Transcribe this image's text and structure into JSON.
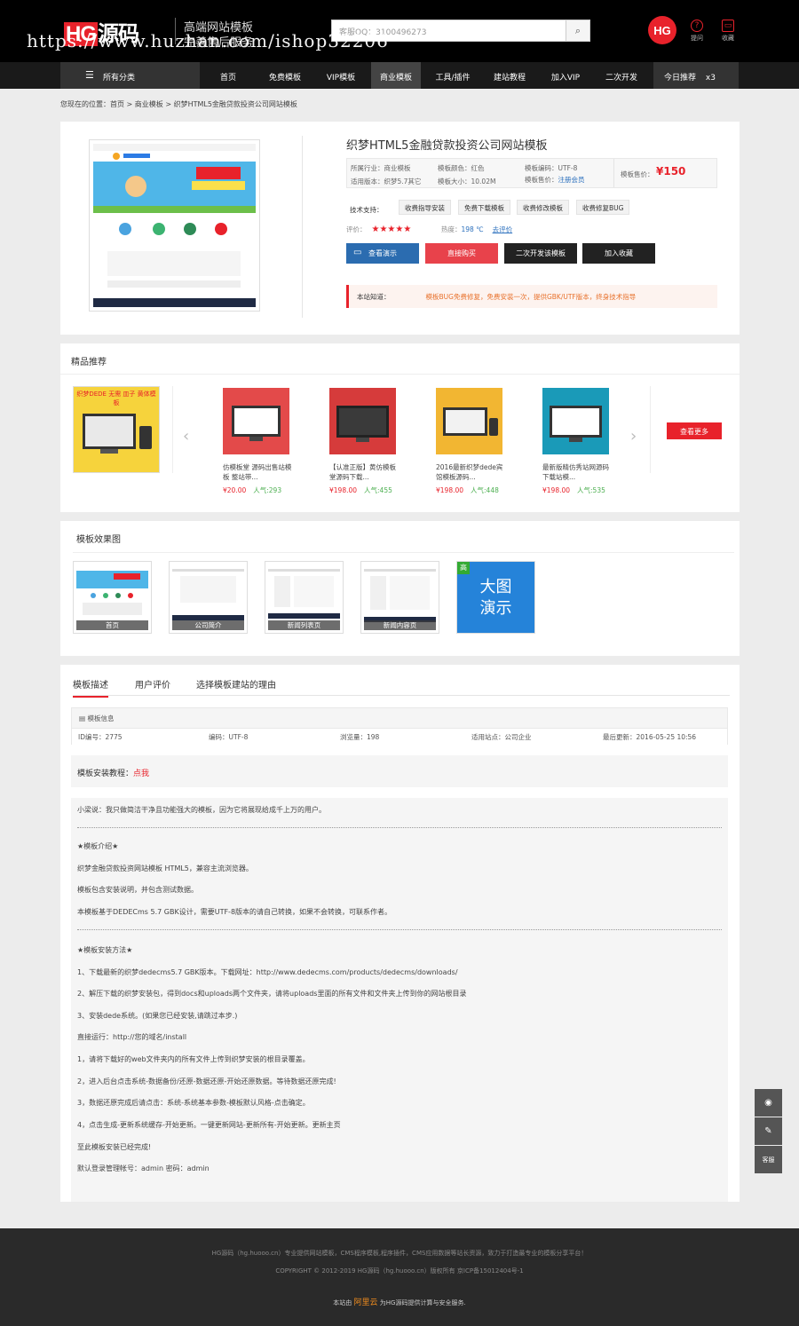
{
  "header": {
    "logo_hg": "HG",
    "logo_text": "源码",
    "tagline1": "高端网站模板",
    "tagline2": "完善售后服务",
    "watermark": "https://www.huzhan.com/ishop32206",
    "search_placeholder": "客服QQ：3100496273",
    "brand_badge": "HG",
    "icon1_label": "提问",
    "icon2_label": "收藏"
  },
  "nav": {
    "all_categories": "所有分类",
    "items": [
      "首页",
      "免费模板",
      "VIP模板",
      "商业模板",
      "工具/插件",
      "建站教程",
      "加入VIP",
      "二次开发"
    ],
    "active_index": 3,
    "recommend": "今日推荐",
    "recommend_suffix": "x3"
  },
  "breadcrumb": "您现在的位置：首页 > 商业模板 > 织梦HTML5金融贷款投资公司网站模板",
  "product": {
    "title": "织梦HTML5金融贷款投资公司网站模板",
    "industry": "所属行业：商业模板",
    "color": "模板颜色：红色",
    "encoding": "模板编码：UTF-8",
    "version": "适用版本：织梦5.7其它",
    "size": "模板大小：10.02M",
    "member_price_label": "模板售价：",
    "member_price_link": "注册会员",
    "price_label": "模板售价：",
    "price": "¥150",
    "tech_label": "技术支持：",
    "tech_items": [
      "收费指导安装",
      "免费下载模板",
      "收费修改模板",
      "收费修复BUG"
    ],
    "rating_label": "评价：",
    "stars": "★★★★★",
    "heat_label": "热度：",
    "heat_value": "198 ℃",
    "comment_link": "去评价",
    "buttons": [
      "查看演示",
      "直接购买",
      "二次开发该模板",
      "加入收藏"
    ],
    "notice_label": "本站知道：",
    "notice_text": "模板BUG免费修复，免费安装一次，提供GBK/UTF版本，终身技术指导"
  },
  "recommend": {
    "title": "精品推荐",
    "more": "查看更多",
    "items": [
      {
        "title": "仿模板堂 源码出售站模板 整站带...",
        "price": "¥20.00",
        "pop": "人气:293",
        "color": "#e34a4a"
      },
      {
        "title": "【认准正版】黄仿模板堂源码下载...",
        "price": "¥198.00",
        "pop": "人气:455",
        "color": "#d63b3b"
      },
      {
        "title": "2016最新织梦dede宾馆模板源码...",
        "price": "¥198.00",
        "pop": "人气:448",
        "color": "#f2b632"
      },
      {
        "title": "最新版精仿秀站网源码下载站模...",
        "price": "¥198.00",
        "pop": "人气:535",
        "color": "#1a9ab8"
      }
    ],
    "first_banner": "织梦DEDE 无需 皿子 黄体模板"
  },
  "effects": {
    "title": "模板效果图",
    "items": [
      "首页",
      "公司简介",
      "新闻列表页",
      "新闻内容页"
    ],
    "big_demo_line1": "大图",
    "big_demo_line2": "演示"
  },
  "details": {
    "tabs": [
      "模板描述",
      "用户评价",
      "选择模板建站的理由"
    ],
    "info_title": "模板信息",
    "id": "ID编号：2775",
    "encoding": "编码：UTF-8",
    "views": "浏览量：198",
    "applies": "适用站点：公司企业",
    "updated": "最后更新：2016-05-25 10:56",
    "tutorial_label": "模板安装教程：",
    "tutorial_link": "点我",
    "lines1": [
      "小梁说：我只做简洁干净且功能强大的模板，因为它将展现给成千上万的用户。"
    ],
    "lines2": [
      "★模板介绍★",
      "织梦金融贷款投资网站模板 HTML5，兼容主流浏览器。",
      "模板包含安装说明，并包含测试数据。",
      "本模板基于DEDECms 5.7 GBK设计，需要UTF-8版本的请自己转换，如果不会转换，可联系作者。"
    ],
    "lines3": [
      "★模板安装方法★",
      "1、下载最新的织梦dedecms5.7 GBK版本。下载网址：http://www.dedecms.com/products/dedecms/downloads/",
      "2、解压下载的织梦安装包，得到docs和uploads两个文件夹，请将uploads里面的所有文件和文件夹上传到你的网站根目录",
      "3、安装dede系统。(如果您已经安装,请跳过本步.)",
      "直接运行：http://您的域名/install",
      "1，请将下载好的web文件夹内的所有文件上传到织梦安装的根目录覆盖。",
      "2，进入后台点击系统-数据备份/还原-数据还原-开始还原数据。等待数据还原完成!",
      "3，数据还原完成后请点击：系统-系统基本参数-模板默认风格-点击确定。",
      "4，点击生成-更新系统缓存-开始更新。一键更新网站-更新所有-开始更新。更新主页",
      "至此模板安装已经完成!",
      "默认登录管理帐号：admin  密码：admin"
    ]
  },
  "side": [
    "QQ",
    "✎",
    "客服"
  ],
  "footer": {
    "line1": "HG源码（hg.huooo.cn）专业提供网站模板，CMS程序模板,程序插件，CMS应用数据等站长资源，致力于打造最专业的模板分享平台！",
    "line2": "COPYRIGHT © 2012-2019 HG源码（hg.huooo.cn）版权所有 京ICP备15012404号-1",
    "line3_pre": "本站由",
    "line3_brand": "阿里云",
    "line3_post": "为HG源码提供计算与安全服务."
  }
}
